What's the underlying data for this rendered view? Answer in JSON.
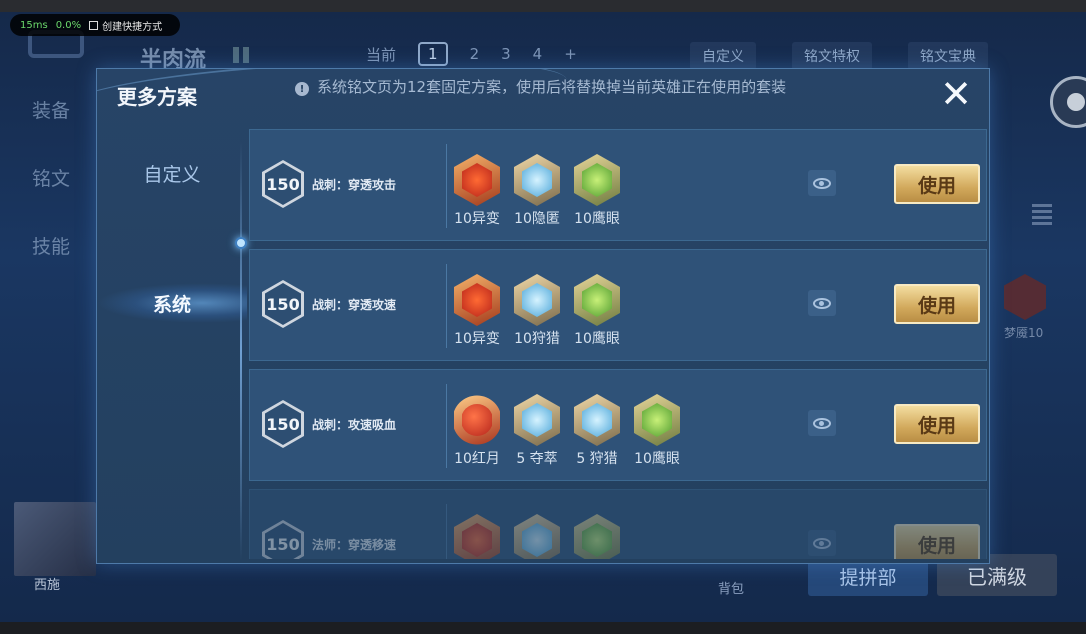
{
  "overlay": {
    "frame_time": "15ms",
    "cpu": "0.0%",
    "shortcut_label": "创建快捷方式"
  },
  "background": {
    "title": "半肉流",
    "tabs": [
      "当前",
      "1",
      "2",
      "3",
      "4",
      "+"
    ],
    "right_buttons": [
      "自定义",
      "铭文特权",
      "铭文宝典"
    ],
    "side_nav": [
      "装备",
      "铭文",
      "技能"
    ],
    "hero_name": "西施",
    "bag_label": "背包",
    "generate_button": "提拼部",
    "max_button": "已满级",
    "side_rune_label": "梦魇10"
  },
  "modal": {
    "title": "更多方案",
    "info_text": "系统铭文页为12套固定方案，使用后将替换掉当前英雄正在使用的套装",
    "close_label": "✕",
    "nav": [
      {
        "label": "自定义",
        "active": false
      },
      {
        "label": "系统",
        "active": true
      }
    ],
    "use_label": "使用",
    "rows": [
      {
        "level": "150",
        "name": "战刺：穿透攻击",
        "runes": [
          {
            "label": "10异变",
            "color": "red",
            "icon": "rune-red-icon"
          },
          {
            "label": "10隐匿",
            "color": "blue",
            "icon": "rune-blue-icon"
          },
          {
            "label": "10鹰眼",
            "color": "green",
            "icon": "rune-green-icon"
          }
        ]
      },
      {
        "level": "150",
        "name": "战刺：穿透攻速",
        "runes": [
          {
            "label": "10异变",
            "color": "red",
            "icon": "rune-red-icon"
          },
          {
            "label": "10狩猎",
            "color": "blue",
            "icon": "rune-blue-icon"
          },
          {
            "label": "10鹰眼",
            "color": "green",
            "icon": "rune-green-icon"
          }
        ]
      },
      {
        "level": "150",
        "name": "战刺：攻速吸血",
        "runes": [
          {
            "label": "10红月",
            "color": "circle",
            "icon": "rune-red-icon"
          },
          {
            "label": "5 夺萃",
            "color": "blue",
            "icon": "rune-blue-icon"
          },
          {
            "label": "5 狩猎",
            "color": "blue",
            "icon": "rune-blue-icon"
          },
          {
            "label": "10鹰眼",
            "color": "green",
            "icon": "rune-green-icon"
          }
        ]
      },
      {
        "level": "150",
        "name": "法师：穿透移速",
        "runes": [
          {
            "label": "",
            "color": "red",
            "icon": "rune-red-icon"
          },
          {
            "label": "",
            "color": "blue",
            "icon": "rune-blue-icon"
          },
          {
            "label": "",
            "color": "green",
            "icon": "rune-green-icon"
          }
        ]
      }
    ]
  }
}
